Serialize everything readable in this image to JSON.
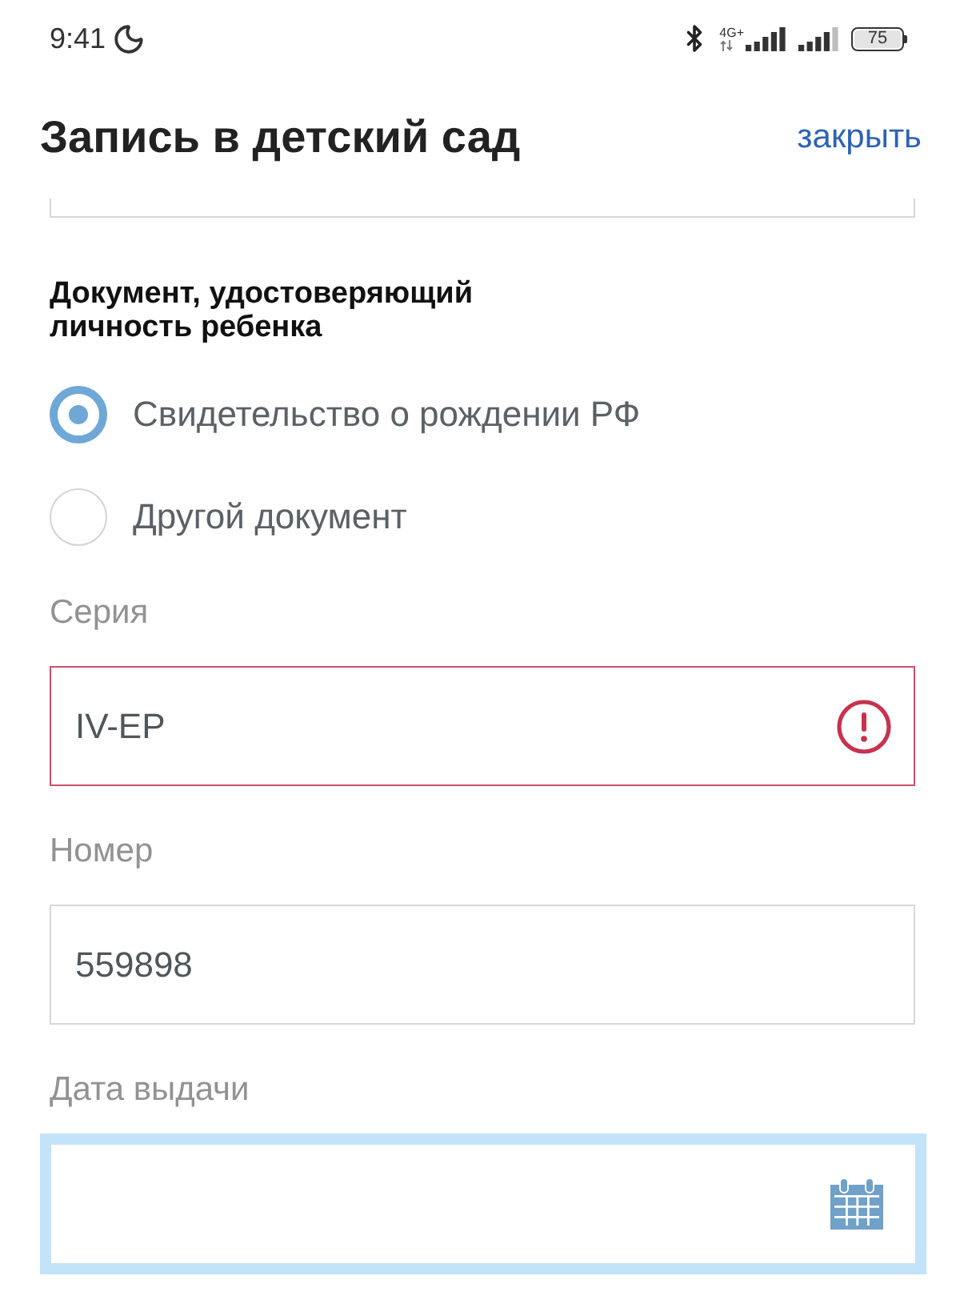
{
  "status_bar": {
    "time": "9:41",
    "network_type": "4G+",
    "battery": "75"
  },
  "header": {
    "title": "Запись в детский сад",
    "close": "закрыть"
  },
  "document_section": {
    "title": "Документ, удостоверяющий личность ребенка",
    "options": [
      {
        "label": "Свидетельство о рождении РФ",
        "selected": true
      },
      {
        "label": "Другой документ",
        "selected": false
      }
    ]
  },
  "fields": [
    {
      "kind": "text",
      "label": "Серия",
      "value": "IV-EP",
      "error": true,
      "focused": false
    },
    {
      "kind": "text",
      "label": "Номер",
      "value": "559898",
      "error": false,
      "focused": false
    },
    {
      "kind": "date",
      "label": "Дата выдачи",
      "error": false,
      "focused": true
    }
  ]
}
